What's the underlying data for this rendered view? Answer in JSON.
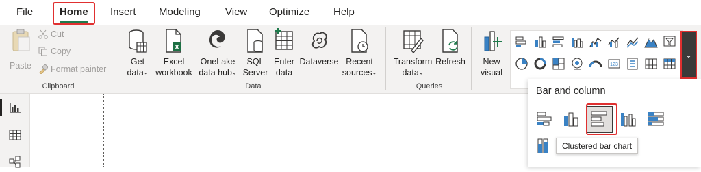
{
  "menu": {
    "items": [
      "File",
      "Home",
      "Insert",
      "Modeling",
      "View",
      "Optimize",
      "Help"
    ],
    "active": "Home"
  },
  "ribbon": {
    "clipboard": {
      "paste": "Paste",
      "cut": "Cut",
      "copy": "Copy",
      "format_painter": "Format painter",
      "label": "Clipboard"
    },
    "data": {
      "get_data": [
        "Get",
        "data"
      ],
      "excel": [
        "Excel",
        "workbook"
      ],
      "onelake": [
        "OneLake",
        "data hub"
      ],
      "sql": [
        "SQL",
        "Server"
      ],
      "enter": [
        "Enter",
        "data"
      ],
      "dataverse": "Dataverse",
      "recent": [
        "Recent",
        "sources"
      ],
      "label": "Data"
    },
    "queries": {
      "transform": [
        "Transform",
        "data"
      ],
      "refresh": "Refresh",
      "label": "Queries"
    },
    "insert": {
      "new_visual": [
        "New",
        "visual"
      ]
    }
  },
  "flyout": {
    "title": "Bar and column",
    "tooltip": "Clustered bar chart"
  },
  "colors": {
    "accent_green": "#1f7a4c",
    "highlight_red": "#e03030",
    "chart_blue": "#3a82c4",
    "icon_dark": "#3b3a39"
  },
  "icons": {
    "visual_gallery": [
      "stacked-bar-chart-icon",
      "stacked-column-chart-icon",
      "clustered-bar-chart-icon",
      "clustered-column-chart-icon",
      "100-stacked-bar-chart-icon",
      "100-stacked-column-chart-icon",
      "line-chart-icon",
      "area-chart-icon",
      "funnel-filter-icon",
      "pie-chart-icon",
      "donut-chart-icon",
      "treemap-icon",
      "map-icon",
      "gauge-icon",
      "card-icon",
      "multi-row-card-icon",
      "table-icon",
      "matrix-icon"
    ],
    "flyout_row1": [
      "stacked-bar-chart-icon",
      "stacked-column-chart-icon",
      "clustered-bar-chart-icon",
      "clustered-column-chart-icon",
      "100-stacked-bar-chart-icon"
    ],
    "flyout_row2": [
      "100-stacked-column-chart-icon"
    ]
  }
}
